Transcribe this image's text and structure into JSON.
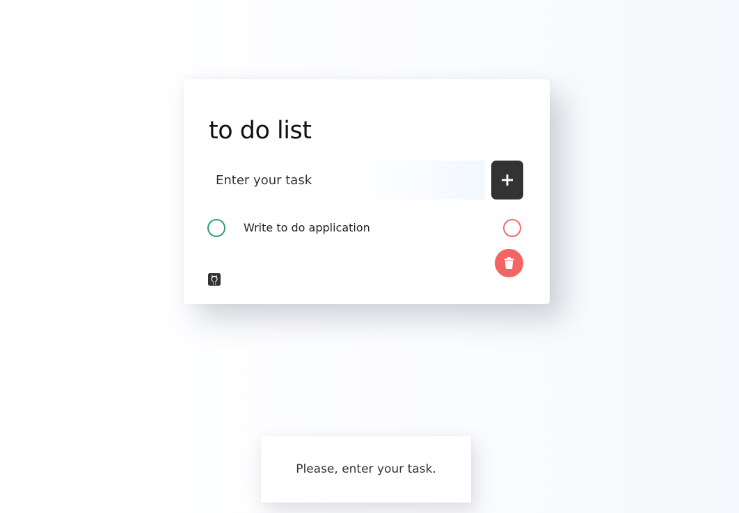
{
  "app": {
    "title": "to do list"
  },
  "input": {
    "placeholder": "Enter your task",
    "value": ""
  },
  "add_button": {
    "icon": "plus-icon"
  },
  "tasks": [
    {
      "label": "Write to do application",
      "complete_icon": "circle-icon",
      "remove_icon": "circle-icon"
    }
  ],
  "delete_all_button": {
    "icon": "trash-icon"
  },
  "footer": {
    "icon": "github-icon"
  },
  "toast": {
    "message": "Please, enter your task."
  },
  "colors": {
    "accent_dark": "#333333",
    "complete": "#2e9e84",
    "danger": "#f56464"
  }
}
